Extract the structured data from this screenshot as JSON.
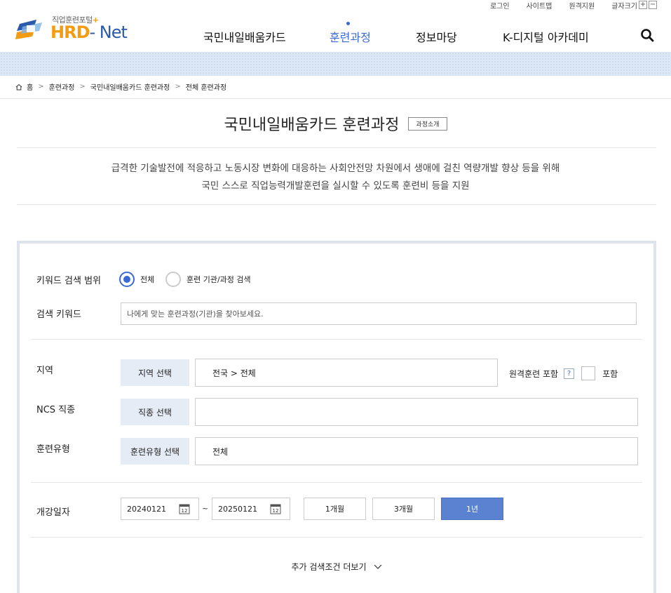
{
  "util": {
    "login": "로그인",
    "sitemap": "사이트맵",
    "remote": "원격지원",
    "fontsize": "글자크기",
    "plus": "+",
    "minus": "−"
  },
  "logo": {
    "top_text": "직업훈련포털",
    "plus": "+",
    "main": "HRD",
    "sub": "- Net"
  },
  "gnb": [
    "국민내일배움카드",
    "훈련과정",
    "정보마당",
    "K-디지털 아카데미"
  ],
  "breadcrumb": [
    "홈",
    "훈련과정",
    "국민내일배움카드 훈련과정",
    "전체 훈련과정"
  ],
  "page": {
    "title": "국민내일배움카드 훈련과정",
    "title_tag": "과정소개",
    "desc_line1": "급격한 기술발전에 적응하고 노동시장 변화에 대응하는 사회안전망 차원에서 생애에 걸친 역량개발 향상 등을 위해",
    "desc_line2": "국민 스스로 직업능력개발훈련을 실시할 수 있도록 훈련비 등을 지원"
  },
  "search": {
    "scope_label": "키워드 검색 범위",
    "scope_all": "전체",
    "scope_inst": "훈련 기관/과정 검색",
    "keyword_label": "검색 키워드",
    "keyword_placeholder": "나에게 맞는 훈련과정(기관)을 찾아보세요.",
    "region_label": "지역",
    "region_btn": "지역 선택",
    "region_value": "전국 > 전체",
    "remote_label": "원격훈련 포함",
    "remote_q": "?",
    "remote_chk_label": "포함",
    "ncs_label": "NCS 직종",
    "ncs_btn": "직종 선택",
    "ncs_value": "",
    "type_label": "훈련유형",
    "type_btn": "훈련유형 선택",
    "type_value": "전체",
    "date_label": "개강일자",
    "date_from": "20240121",
    "date_to": "20250121",
    "tilde": "~",
    "period": [
      "1개월",
      "3개월",
      "1년"
    ],
    "more": "추가 검색조건 더보기"
  },
  "colors": {
    "accent": "#3b6ad2",
    "button_bg": "#e6ecf6",
    "active_period": "#5a82d0"
  }
}
